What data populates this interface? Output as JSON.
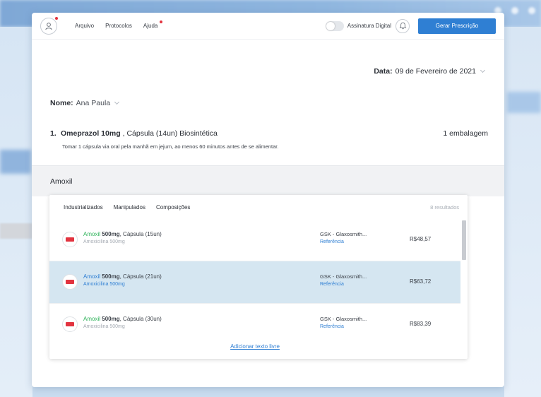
{
  "nav": {
    "items": [
      "Arquivo",
      "Protocolos",
      "Ajuda"
    ],
    "signature_label": "Assinatura Digital",
    "primary_button": "Gerar Prescrição"
  },
  "date": {
    "label": "Data:",
    "value": "09 de Fevereiro de 2021"
  },
  "patient": {
    "label": "Nome:",
    "value": "Ana Paula"
  },
  "prescription": {
    "number": "1.",
    "drug_bold": "Omeprazol 10mg",
    "drug_rest": ", Cápsula (14un) Biosintética",
    "quantity": "1 embalagem",
    "instructions": "Tomar 1 cápsula via oral pela manhã em jejum, ao menos 60 minutos antes de se alimentar."
  },
  "search": {
    "value": "Amoxil"
  },
  "results": {
    "tabs": [
      "Industrializados",
      "Manipulados",
      "Composições"
    ],
    "count": "8 resultados",
    "items": [
      {
        "brand": "Amoxil",
        "dose": "500mg",
        "form": ", Cápsula (15un)",
        "substance": "Amoxicilina 500mg",
        "lab": "GSK - Glaxosmith...",
        "lab_type": "Referência",
        "price": "R$48,57"
      },
      {
        "brand": "Amoxil",
        "dose": "500mg",
        "form": ", Cápsula (21un)",
        "substance": "Amoxicilina 500mg",
        "lab": "GSK - Glaxosmith...",
        "lab_type": "Referência",
        "price": "R$63,72"
      },
      {
        "brand": "Amoxil",
        "dose": "500mg",
        "form": ", Cápsula (30un)",
        "substance": "Amoxicilina 500mg",
        "lab": "GSK - Glaxosmith...",
        "lab_type": "Referência",
        "price": "R$83,39"
      }
    ],
    "add_free_text": "Adicionar texto livre"
  },
  "colors": {
    "primary": "#2f7fd3",
    "brand_green": "#2fb35a",
    "alert_red": "#e2333f",
    "selected_row": "#d5e6f1"
  },
  "icons": [
    "user-icon",
    "bell-icon",
    "pill-icon",
    "chevron-down-icon"
  ]
}
